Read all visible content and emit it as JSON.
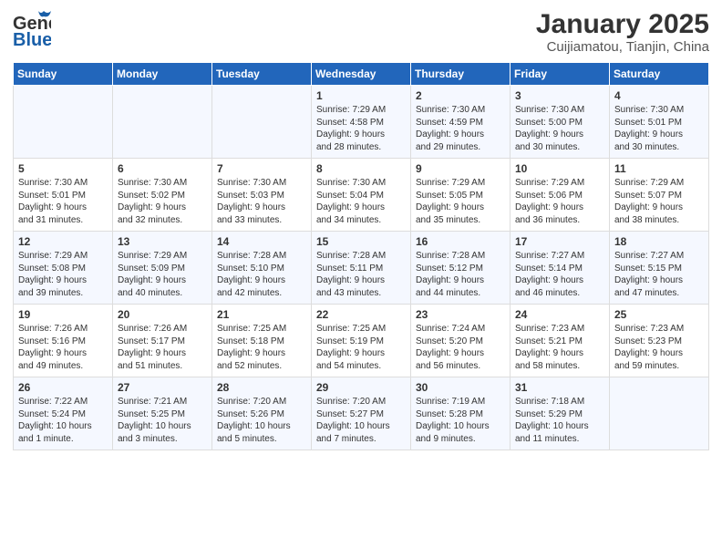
{
  "header": {
    "logo_general": "General",
    "logo_blue": "Blue",
    "title": "January 2025",
    "subtitle": "Cuijiamatou, Tianjin, China"
  },
  "days_of_week": [
    "Sunday",
    "Monday",
    "Tuesday",
    "Wednesday",
    "Thursday",
    "Friday",
    "Saturday"
  ],
  "weeks": [
    [
      {
        "day": "",
        "info": ""
      },
      {
        "day": "",
        "info": ""
      },
      {
        "day": "",
        "info": ""
      },
      {
        "day": "1",
        "info": "Sunrise: 7:29 AM\nSunset: 4:58 PM\nDaylight: 9 hours\nand 28 minutes."
      },
      {
        "day": "2",
        "info": "Sunrise: 7:30 AM\nSunset: 4:59 PM\nDaylight: 9 hours\nand 29 minutes."
      },
      {
        "day": "3",
        "info": "Sunrise: 7:30 AM\nSunset: 5:00 PM\nDaylight: 9 hours\nand 30 minutes."
      },
      {
        "day": "4",
        "info": "Sunrise: 7:30 AM\nSunset: 5:01 PM\nDaylight: 9 hours\nand 30 minutes."
      }
    ],
    [
      {
        "day": "5",
        "info": "Sunrise: 7:30 AM\nSunset: 5:01 PM\nDaylight: 9 hours\nand 31 minutes."
      },
      {
        "day": "6",
        "info": "Sunrise: 7:30 AM\nSunset: 5:02 PM\nDaylight: 9 hours\nand 32 minutes."
      },
      {
        "day": "7",
        "info": "Sunrise: 7:30 AM\nSunset: 5:03 PM\nDaylight: 9 hours\nand 33 minutes."
      },
      {
        "day": "8",
        "info": "Sunrise: 7:30 AM\nSunset: 5:04 PM\nDaylight: 9 hours\nand 34 minutes."
      },
      {
        "day": "9",
        "info": "Sunrise: 7:29 AM\nSunset: 5:05 PM\nDaylight: 9 hours\nand 35 minutes."
      },
      {
        "day": "10",
        "info": "Sunrise: 7:29 AM\nSunset: 5:06 PM\nDaylight: 9 hours\nand 36 minutes."
      },
      {
        "day": "11",
        "info": "Sunrise: 7:29 AM\nSunset: 5:07 PM\nDaylight: 9 hours\nand 38 minutes."
      }
    ],
    [
      {
        "day": "12",
        "info": "Sunrise: 7:29 AM\nSunset: 5:08 PM\nDaylight: 9 hours\nand 39 minutes."
      },
      {
        "day": "13",
        "info": "Sunrise: 7:29 AM\nSunset: 5:09 PM\nDaylight: 9 hours\nand 40 minutes."
      },
      {
        "day": "14",
        "info": "Sunrise: 7:28 AM\nSunset: 5:10 PM\nDaylight: 9 hours\nand 42 minutes."
      },
      {
        "day": "15",
        "info": "Sunrise: 7:28 AM\nSunset: 5:11 PM\nDaylight: 9 hours\nand 43 minutes."
      },
      {
        "day": "16",
        "info": "Sunrise: 7:28 AM\nSunset: 5:12 PM\nDaylight: 9 hours\nand 44 minutes."
      },
      {
        "day": "17",
        "info": "Sunrise: 7:27 AM\nSunset: 5:14 PM\nDaylight: 9 hours\nand 46 minutes."
      },
      {
        "day": "18",
        "info": "Sunrise: 7:27 AM\nSunset: 5:15 PM\nDaylight: 9 hours\nand 47 minutes."
      }
    ],
    [
      {
        "day": "19",
        "info": "Sunrise: 7:26 AM\nSunset: 5:16 PM\nDaylight: 9 hours\nand 49 minutes."
      },
      {
        "day": "20",
        "info": "Sunrise: 7:26 AM\nSunset: 5:17 PM\nDaylight: 9 hours\nand 51 minutes."
      },
      {
        "day": "21",
        "info": "Sunrise: 7:25 AM\nSunset: 5:18 PM\nDaylight: 9 hours\nand 52 minutes."
      },
      {
        "day": "22",
        "info": "Sunrise: 7:25 AM\nSunset: 5:19 PM\nDaylight: 9 hours\nand 54 minutes."
      },
      {
        "day": "23",
        "info": "Sunrise: 7:24 AM\nSunset: 5:20 PM\nDaylight: 9 hours\nand 56 minutes."
      },
      {
        "day": "24",
        "info": "Sunrise: 7:23 AM\nSunset: 5:21 PM\nDaylight: 9 hours\nand 58 minutes."
      },
      {
        "day": "25",
        "info": "Sunrise: 7:23 AM\nSunset: 5:23 PM\nDaylight: 9 hours\nand 59 minutes."
      }
    ],
    [
      {
        "day": "26",
        "info": "Sunrise: 7:22 AM\nSunset: 5:24 PM\nDaylight: 10 hours\nand 1 minute."
      },
      {
        "day": "27",
        "info": "Sunrise: 7:21 AM\nSunset: 5:25 PM\nDaylight: 10 hours\nand 3 minutes."
      },
      {
        "day": "28",
        "info": "Sunrise: 7:20 AM\nSunset: 5:26 PM\nDaylight: 10 hours\nand 5 minutes."
      },
      {
        "day": "29",
        "info": "Sunrise: 7:20 AM\nSunset: 5:27 PM\nDaylight: 10 hours\nand 7 minutes."
      },
      {
        "day": "30",
        "info": "Sunrise: 7:19 AM\nSunset: 5:28 PM\nDaylight: 10 hours\nand 9 minutes."
      },
      {
        "day": "31",
        "info": "Sunrise: 7:18 AM\nSunset: 5:29 PM\nDaylight: 10 hours\nand 11 minutes."
      },
      {
        "day": "",
        "info": ""
      }
    ]
  ]
}
